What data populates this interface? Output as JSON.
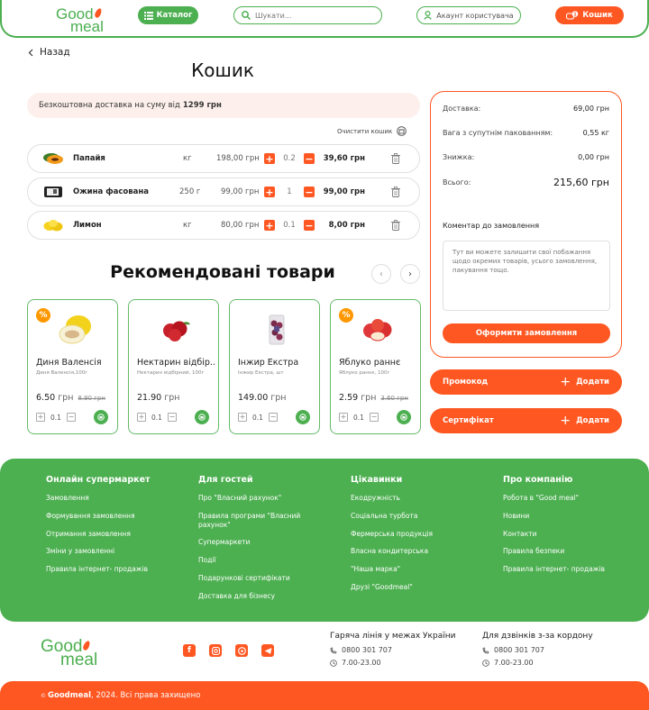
{
  "header": {
    "logo_line1": "Good",
    "logo_line2": "meal",
    "catalog_label": "Каталог",
    "search_placeholder": "Шукати...",
    "account_label": "Акаунт користувача",
    "cart_label": "Кошик",
    "cart_count": "1"
  },
  "page": {
    "back_label": "Назад",
    "title": "Кошик",
    "free_delivery_text": "Безкоштовна доставка на суму від",
    "free_delivery_amount": "1299 грн",
    "clear_cart_label": "Очистити кошик"
  },
  "cart": {
    "items": [
      {
        "name": "Папайя",
        "unit": "кг",
        "price": "198,00 грн",
        "qty": "0.2",
        "total": "39,60 грн",
        "icon": "papaya-image"
      },
      {
        "name": "Ожина фасована",
        "unit": "250 г",
        "price": "99,00 грн",
        "qty": "1",
        "total": "99,00 грн",
        "icon": "blackberry-pack-image"
      },
      {
        "name": "Лимон",
        "unit": "кг",
        "price": "80,00 грн",
        "qty": "0.1",
        "total": "8,00 грн",
        "icon": "lemon-image"
      }
    ]
  },
  "summary": {
    "delivery_label": "Доставка:",
    "delivery_value": "69,00 грн",
    "weight_label": "Вага з супутнім пакованням:",
    "weight_value": "0,55 кг",
    "discount_label": "Знижка:",
    "discount_value": "0,00 грн",
    "total_label": "Всього:",
    "total_value": "215,60 грн",
    "comment_label": "Коментар до замовлення",
    "comment_placeholder": "Тут ви можете залишити свої побажання щодо окремих товарів, усього замовлення, пакування тощо.",
    "checkout_label": "Оформити замовлення",
    "promo_label": "Промокод",
    "certificate_label": "Сертифікат",
    "add_label": "Додати"
  },
  "recommended": {
    "title": "Рекомендовані товари",
    "products": [
      {
        "name": "Диня Валенсія",
        "desc": "Диня Валенсія,100г",
        "price": "6.50",
        "old_price": "8.90 грн",
        "currency": "грн",
        "qty": "0.1",
        "discount": true
      },
      {
        "name": "Нектарин відбір...",
        "desc": "Нектарин відбірний, 100г",
        "price": "21.90",
        "old_price": "",
        "currency": "грн",
        "qty": "0.1",
        "discount": false
      },
      {
        "name": "Інжир Екстра",
        "desc": "Інжир Екстра, шт",
        "price": "149.00",
        "old_price": "",
        "currency": "грн",
        "qty": "0.1",
        "discount": false
      },
      {
        "name": "Яблуко раннє",
        "desc": "Яблуко раннє, 100г",
        "price": "2.59",
        "old_price": "3.60 грн",
        "currency": "грн",
        "qty": "0.1",
        "discount": true
      }
    ]
  },
  "footer": {
    "columns": [
      {
        "title": "Онлайн супермаркет",
        "links": [
          "Замовлення",
          "Формування замовлення",
          "Отримання замовлення",
          "Зміни у замовленні",
          "Правила інтернет- продажів"
        ]
      },
      {
        "title": "Для гостей",
        "links": [
          "Про \"Власний рахунок\"",
          "Правила програми \"Власний рахунок\"",
          "Супермаркети",
          "Події",
          "Подарункові сертифікати",
          "Доставка для бізнесу"
        ]
      },
      {
        "title": "Цікавинки",
        "links": [
          "Екодружність",
          "Соціальна турбота",
          "Фермерська продукція",
          "Власна кондитерська",
          "\"Наша марка\"",
          "Друзі \"Goodmeal\""
        ]
      },
      {
        "title": "Про компанію",
        "links": [
          "Робота в \"Good meal\"",
          "Новини",
          "Контакти",
          "Правила безпеки",
          "Правила інтернет- продажів"
        ]
      }
    ],
    "hotline_title": "Гаряча лінія у межах України",
    "hotline_phone": "0800 301 707",
    "hotline_hours": "7.00-23.00",
    "intl_title": "Для дзвінків з-за кордону",
    "intl_phone": "0800 301 707",
    "intl_hours": "7.00-23.00",
    "copyright_brand": "Goodmeal",
    "copyright_text": ", 2024. Всі права захищено",
    "social": [
      "facebook",
      "instagram",
      "viber",
      "telegram"
    ]
  },
  "colors": {
    "green": "#4caf50",
    "orange": "#ff5722",
    "badge": "#ff9800"
  }
}
